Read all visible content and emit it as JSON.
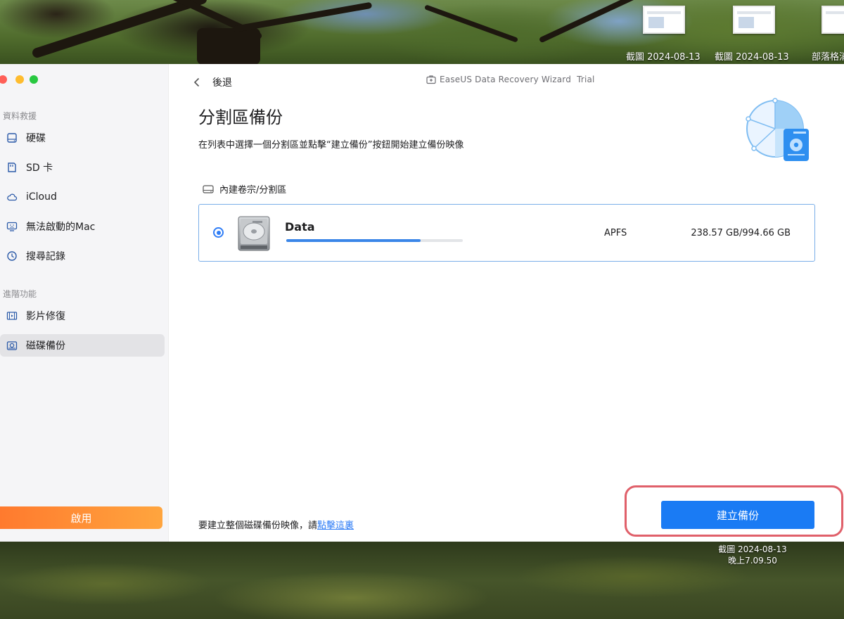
{
  "desktop": {
    "thumbnails": [
      {
        "label": "截圖 2024-08-13"
      },
      {
        "label": "截圖 2024-08-13"
      },
      {
        "label": "部落格消"
      }
    ],
    "screenshot_file": {
      "line1": "截圖 2024-08-13",
      "line2": "晚上7.09.50"
    }
  },
  "window": {
    "title": "EaseUS Data Recovery Wizard  Trial",
    "traffic_lights": {
      "close": "#ff5f57",
      "minimize": "#febc2e",
      "zoom": "#28c840"
    }
  },
  "sidebar": {
    "section_recovery": "資料救援",
    "recovery_items": [
      {
        "label": "硬碟",
        "icon": "hard-drive-icon"
      },
      {
        "label": "SD 卡",
        "icon": "sd-card-icon"
      },
      {
        "label": "iCloud",
        "icon": "cloud-icon"
      },
      {
        "label": "無法啟動的Mac",
        "icon": "unbootable-mac-icon"
      },
      {
        "label": "搜尋記錄",
        "icon": "history-icon"
      }
    ],
    "section_advanced": "進階功能",
    "advanced_items": [
      {
        "label": "影片修復",
        "icon": "video-repair-icon"
      },
      {
        "label": "磁碟備份",
        "icon": "disk-backup-icon",
        "active": true
      }
    ],
    "activate_label": "啟用"
  },
  "main": {
    "back_label": "後退",
    "title": "分割區備份",
    "subtitle": "在列表中選擇一個分割區並點擊“建立備份”按鈕開始建立備份映像",
    "list_header": "內建卷宗/分割區",
    "partitions": [
      {
        "name": "Data",
        "filesystem": "APFS",
        "size": "238.57 GB/994.66 GB",
        "usage_fraction": 0.76,
        "selected": true
      }
    ],
    "footer_text": "要建立整個磁碟備份映像，請",
    "footer_link": "點擊這裏",
    "create_button": "建立備份"
  },
  "colors": {
    "accent": "#1a7bf4",
    "activate_orange": "#ff8c33",
    "highlight_red": "#e0606a"
  }
}
